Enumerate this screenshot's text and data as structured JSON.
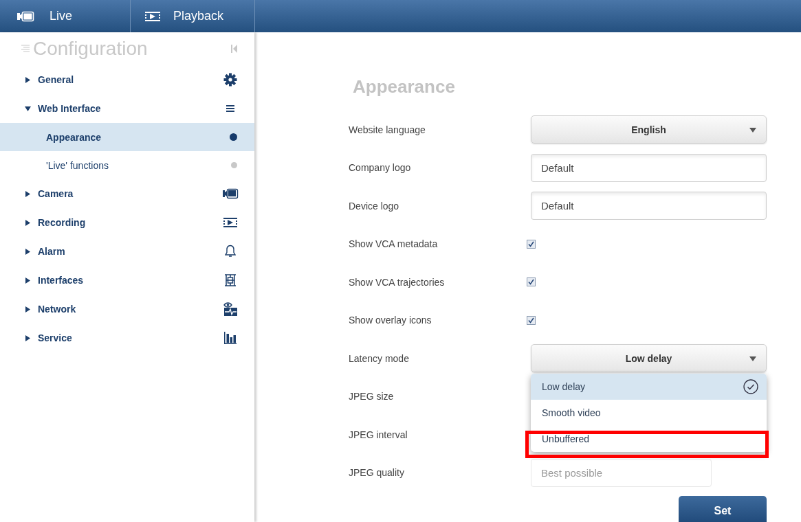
{
  "top_tabs": [
    {
      "label": "Live",
      "selected": false
    },
    {
      "label": "Playback",
      "selected": false
    }
  ],
  "sidebar": {
    "title": "Configuration",
    "items": [
      {
        "label": "General",
        "expanded": false
      },
      {
        "label": "Web Interface",
        "expanded": true,
        "children": [
          {
            "label": "Appearance",
            "selected": true
          },
          {
            "label": "'Live' functions",
            "selected": false
          }
        ]
      },
      {
        "label": "Camera",
        "expanded": false
      },
      {
        "label": "Recording",
        "expanded": false
      },
      {
        "label": "Alarm",
        "expanded": false
      },
      {
        "label": "Interfaces",
        "expanded": false
      },
      {
        "label": "Network",
        "expanded": false
      },
      {
        "label": "Service",
        "expanded": false
      }
    ]
  },
  "page": {
    "title": "Appearance",
    "rows": [
      {
        "label": "Website language",
        "kind": "select",
        "value": "English"
      },
      {
        "label": "Company logo",
        "kind": "text",
        "value": "Default",
        "disabled": false
      },
      {
        "label": "Device logo",
        "kind": "text",
        "value": "Default",
        "disabled": false
      },
      {
        "label": "Show VCA metadata",
        "kind": "checkbox",
        "checked": true
      },
      {
        "label": "Show VCA trajectories",
        "kind": "checkbox",
        "checked": true
      },
      {
        "label": "Show overlay icons",
        "kind": "checkbox",
        "checked": true
      },
      {
        "label": "Latency mode",
        "kind": "select",
        "value": "Low delay",
        "open": true,
        "options": [
          {
            "label": "Low delay",
            "selected": true,
            "highlighted": false
          },
          {
            "label": "Smooth video",
            "selected": false,
            "highlighted": false
          },
          {
            "label": "Unbuffered",
            "selected": false,
            "highlighted": true
          }
        ]
      },
      {
        "label": "JPEG size",
        "kind": "covered"
      },
      {
        "label": "JPEG interval",
        "kind": "covered"
      },
      {
        "label": "JPEG quality",
        "kind": "text",
        "placeholder": "Best possible",
        "disabled": true
      }
    ],
    "submit": "Set"
  }
}
